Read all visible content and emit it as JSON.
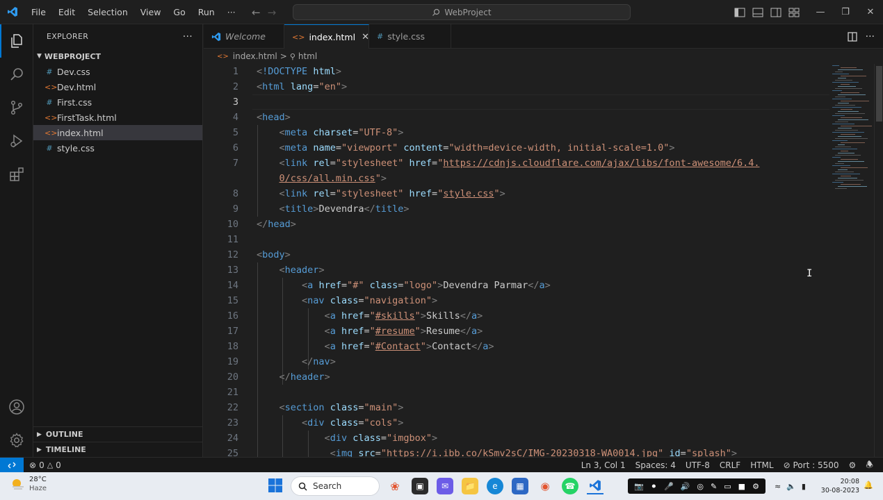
{
  "titlebar": {
    "menu": [
      "File",
      "Edit",
      "Selection",
      "View",
      "Go",
      "Run",
      "···"
    ],
    "search_text": "WebProject"
  },
  "sidebar": {
    "title": "EXPLORER",
    "more": "···",
    "folder": "WEBPROJECT",
    "files": [
      {
        "name": "Dev.css",
        "icon": "#",
        "color": "#519aba"
      },
      {
        "name": "Dev.html",
        "icon": "<>",
        "color": "#e37933"
      },
      {
        "name": "First.css",
        "icon": "#",
        "color": "#519aba"
      },
      {
        "name": "FirstTask.html",
        "icon": "<>",
        "color": "#e37933"
      },
      {
        "name": "index.html",
        "icon": "<>",
        "color": "#e37933"
      },
      {
        "name": "style.css",
        "icon": "#",
        "color": "#519aba"
      }
    ],
    "outline": "OUTLINE",
    "timeline": "TIMELINE"
  },
  "tabs": [
    {
      "label": "Welcome",
      "icon": "vscode-icon"
    },
    {
      "label": "index.html",
      "icon": "<>",
      "close": "✕"
    },
    {
      "label": "style.css",
      "icon": "#"
    }
  ],
  "breadcrumb": {
    "file": "index.html",
    "sep": ">",
    "node": "html"
  },
  "editor": {
    "line_numbers": [
      "1",
      "2",
      "3",
      "4",
      "5",
      "6",
      "7",
      "",
      "8",
      "9",
      "10",
      "11",
      "12",
      "13",
      "14",
      "15",
      "16",
      "17",
      "18",
      "19",
      "20",
      "21",
      "22",
      "23",
      "24",
      "25"
    ],
    "lines": [
      [
        [
          "p",
          "<"
        ],
        [
          "t",
          "!DOCTYPE"
        ],
        [
          "x",
          " "
        ],
        [
          "a",
          "html"
        ],
        [
          "p",
          ">"
        ]
      ],
      [
        [
          "p",
          "<"
        ],
        [
          "t",
          "html"
        ],
        [
          "x",
          " "
        ],
        [
          "a",
          "lang"
        ],
        [
          "x",
          "="
        ],
        [
          "s",
          "\"en\""
        ],
        [
          "p",
          ">"
        ]
      ],
      [],
      [
        [
          "p",
          "<"
        ],
        [
          "t",
          "head"
        ],
        [
          "p",
          ">"
        ]
      ],
      [
        [
          "x",
          "    "
        ],
        [
          "p",
          "<"
        ],
        [
          "t",
          "meta"
        ],
        [
          "x",
          " "
        ],
        [
          "a",
          "charset"
        ],
        [
          "x",
          "="
        ],
        [
          "s",
          "\"UTF-8\""
        ],
        [
          "p",
          ">"
        ]
      ],
      [
        [
          "x",
          "    "
        ],
        [
          "p",
          "<"
        ],
        [
          "t",
          "meta"
        ],
        [
          "x",
          " "
        ],
        [
          "a",
          "name"
        ],
        [
          "x",
          "="
        ],
        [
          "s",
          "\"viewport\""
        ],
        [
          "x",
          " "
        ],
        [
          "a",
          "content"
        ],
        [
          "x",
          "="
        ],
        [
          "s",
          "\"width=device-width, initial-scale=1.0\""
        ],
        [
          "p",
          ">"
        ]
      ],
      [
        [
          "x",
          "    "
        ],
        [
          "p",
          "<"
        ],
        [
          "t",
          "link"
        ],
        [
          "x",
          " "
        ],
        [
          "a",
          "rel"
        ],
        [
          "x",
          "="
        ],
        [
          "s",
          "\"stylesheet\""
        ],
        [
          "x",
          " "
        ],
        [
          "a",
          "href"
        ],
        [
          "x",
          "="
        ],
        [
          "s",
          "\""
        ],
        [
          "su",
          "https://cdnjs.cloudflare.com/ajax/libs/font-awesome/6.4."
        ]
      ],
      [
        [
          "x",
          "    "
        ],
        [
          "su",
          "0/css/all.min.css"
        ],
        [
          "s",
          "\""
        ],
        [
          "p",
          ">"
        ]
      ],
      [
        [
          "x",
          "    "
        ],
        [
          "p",
          "<"
        ],
        [
          "t",
          "link"
        ],
        [
          "x",
          " "
        ],
        [
          "a",
          "rel"
        ],
        [
          "x",
          "="
        ],
        [
          "s",
          "\"stylesheet\""
        ],
        [
          "x",
          " "
        ],
        [
          "a",
          "href"
        ],
        [
          "x",
          "="
        ],
        [
          "s",
          "\""
        ],
        [
          "su",
          "style.css"
        ],
        [
          "s",
          "\""
        ],
        [
          "p",
          ">"
        ]
      ],
      [
        [
          "x",
          "    "
        ],
        [
          "p",
          "<"
        ],
        [
          "t",
          "title"
        ],
        [
          "p",
          ">"
        ],
        [
          "x",
          "Devendra"
        ],
        [
          "p",
          "</"
        ],
        [
          "t",
          "title"
        ],
        [
          "p",
          ">"
        ]
      ],
      [
        [
          "p",
          "</"
        ],
        [
          "t",
          "head"
        ],
        [
          "p",
          ">"
        ]
      ],
      [],
      [
        [
          "p",
          "<"
        ],
        [
          "t",
          "body"
        ],
        [
          "p",
          ">"
        ]
      ],
      [
        [
          "x",
          "    "
        ],
        [
          "p",
          "<"
        ],
        [
          "t",
          "header"
        ],
        [
          "p",
          ">"
        ]
      ],
      [
        [
          "x",
          "        "
        ],
        [
          "p",
          "<"
        ],
        [
          "t",
          "a"
        ],
        [
          "x",
          " "
        ],
        [
          "a",
          "href"
        ],
        [
          "x",
          "="
        ],
        [
          "s",
          "\"#\""
        ],
        [
          "x",
          " "
        ],
        [
          "a",
          "class"
        ],
        [
          "x",
          "="
        ],
        [
          "s",
          "\"logo\""
        ],
        [
          "p",
          ">"
        ],
        [
          "x",
          "Devendra Parmar"
        ],
        [
          "p",
          "</"
        ],
        [
          "t",
          "a"
        ],
        [
          "p",
          ">"
        ]
      ],
      [
        [
          "x",
          "        "
        ],
        [
          "p",
          "<"
        ],
        [
          "t",
          "nav"
        ],
        [
          "x",
          " "
        ],
        [
          "a",
          "class"
        ],
        [
          "x",
          "="
        ],
        [
          "s",
          "\"navigation\""
        ],
        [
          "p",
          ">"
        ]
      ],
      [
        [
          "x",
          "            "
        ],
        [
          "p",
          "<"
        ],
        [
          "t",
          "a"
        ],
        [
          "x",
          " "
        ],
        [
          "a",
          "href"
        ],
        [
          "x",
          "="
        ],
        [
          "s",
          "\""
        ],
        [
          "su",
          "#skills"
        ],
        [
          "s",
          "\""
        ],
        [
          "p",
          ">"
        ],
        [
          "x",
          "Skills"
        ],
        [
          "p",
          "</"
        ],
        [
          "t",
          "a"
        ],
        [
          "p",
          ">"
        ]
      ],
      [
        [
          "x",
          "            "
        ],
        [
          "p",
          "<"
        ],
        [
          "t",
          "a"
        ],
        [
          "x",
          " "
        ],
        [
          "a",
          "href"
        ],
        [
          "x",
          "="
        ],
        [
          "s",
          "\""
        ],
        [
          "su",
          "#resume"
        ],
        [
          "s",
          "\""
        ],
        [
          "p",
          ">"
        ],
        [
          "x",
          "Resume"
        ],
        [
          "p",
          "</"
        ],
        [
          "t",
          "a"
        ],
        [
          "p",
          ">"
        ]
      ],
      [
        [
          "x",
          "            "
        ],
        [
          "p",
          "<"
        ],
        [
          "t",
          "a"
        ],
        [
          "x",
          " "
        ],
        [
          "a",
          "href"
        ],
        [
          "x",
          "="
        ],
        [
          "s",
          "\""
        ],
        [
          "su",
          "#Contact"
        ],
        [
          "s",
          "\""
        ],
        [
          "p",
          ">"
        ],
        [
          "x",
          "Contact"
        ],
        [
          "p",
          "</"
        ],
        [
          "t",
          "a"
        ],
        [
          "p",
          ">"
        ]
      ],
      [
        [
          "x",
          "        "
        ],
        [
          "p",
          "</"
        ],
        [
          "t",
          "nav"
        ],
        [
          "p",
          ">"
        ]
      ],
      [
        [
          "x",
          "    "
        ],
        [
          "p",
          "</"
        ],
        [
          "t",
          "header"
        ],
        [
          "p",
          ">"
        ]
      ],
      [],
      [
        [
          "x",
          "    "
        ],
        [
          "p",
          "<"
        ],
        [
          "t",
          "section"
        ],
        [
          "x",
          " "
        ],
        [
          "a",
          "class"
        ],
        [
          "x",
          "="
        ],
        [
          "s",
          "\"main\""
        ],
        [
          "p",
          ">"
        ]
      ],
      [
        [
          "x",
          "        "
        ],
        [
          "p",
          "<"
        ],
        [
          "t",
          "div"
        ],
        [
          "x",
          " "
        ],
        [
          "a",
          "class"
        ],
        [
          "x",
          "="
        ],
        [
          "s",
          "\"cols\""
        ],
        [
          "p",
          ">"
        ]
      ],
      [
        [
          "x",
          "            "
        ],
        [
          "p",
          "<"
        ],
        [
          "t",
          "div"
        ],
        [
          "x",
          " "
        ],
        [
          "a",
          "class"
        ],
        [
          "x",
          "="
        ],
        [
          "s",
          "\"imgbox\""
        ],
        [
          "p",
          ">"
        ]
      ],
      [
        [
          "x",
          "             "
        ],
        [
          "p",
          "<"
        ],
        [
          "t",
          "img"
        ],
        [
          "x",
          " "
        ],
        [
          "a",
          "src"
        ],
        [
          "x",
          "="
        ],
        [
          "s",
          "\"https://i.ibb.co/kSmv2sC/IMG-20230318-WA0014.jpg\""
        ],
        [
          "x",
          " "
        ],
        [
          "a",
          "id"
        ],
        [
          "x",
          "="
        ],
        [
          "s",
          "\"splash\""
        ],
        [
          "p",
          ">"
        ]
      ]
    ]
  },
  "statusbar": {
    "errors": "0",
    "warnings": "0",
    "position": "Ln 3, Col 1",
    "spaces": "Spaces: 4",
    "encoding": "UTF-8",
    "eol": "CRLF",
    "language": "HTML",
    "port": "Port : 5500"
  },
  "taskbar": {
    "temp": "28°C",
    "weather": "Haze",
    "search": "Search",
    "time": "20:08",
    "date": "30-08-2023"
  },
  "colors": {
    "accent": "#0078d4",
    "editor_bg": "#1f1f1f",
    "sidebar_bg": "#181818"
  }
}
